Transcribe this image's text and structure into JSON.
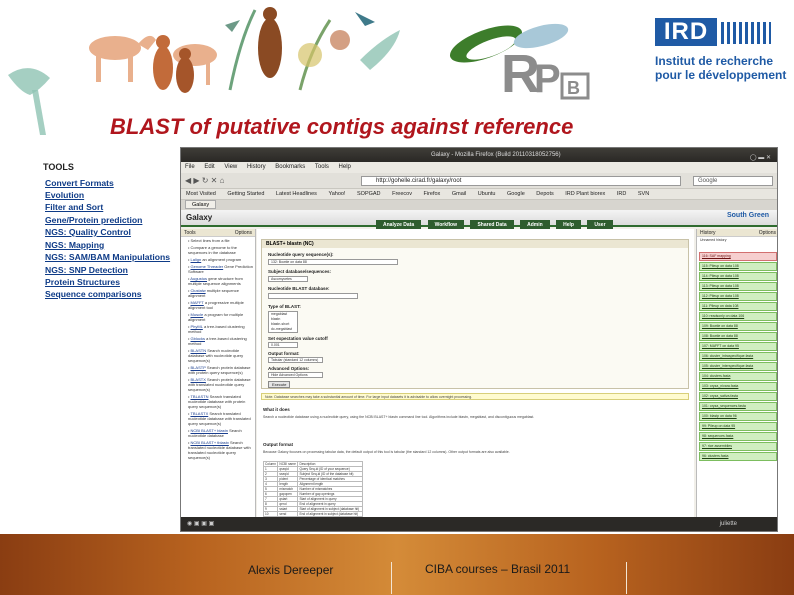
{
  "slide": {
    "title": "BLAST of putative contigs against reference",
    "footer": {
      "author": "Alexis Dereeper",
      "course": "CIBA courses – Brasil 2011"
    }
  },
  "logos": {
    "rpb": "RPB",
    "ird": {
      "wordmark": "IRD",
      "line1": "Institut de recherche",
      "line2": "pour le développement"
    }
  },
  "tools_panel": {
    "title": "TOOLS",
    "items": [
      "Convert Formats",
      "Evolution",
      "Filter and Sort",
      "Gene/Protein prediction",
      "NGS: Quality Control",
      "NGS: Mapping",
      "NGS: SAM/BAM Manipulations",
      "NGS: SNP Detection",
      "Protein Structures",
      "Sequence comparisons"
    ]
  },
  "browser": {
    "window_title": "Galaxy - Mozilla Firefox (Build 20110318052756)",
    "menu": [
      "File",
      "Edit",
      "View",
      "History",
      "Bookmarks",
      "Tools",
      "Help"
    ],
    "url": "http://gohelle.cirad.fr/galaxy/root",
    "search_placeholder": "Google",
    "bookmarks": [
      "Most Visited",
      "Getting Started",
      "Latest Headlines",
      "Yahoo!",
      "SOPGAD",
      "Freecov",
      "Firefox",
      "Gmail",
      "Ubuntu",
      "Google",
      "Depots",
      "IRD Plant biorex",
      "IRD",
      "SVN"
    ],
    "tab": "Galaxy",
    "status_left": "",
    "status_right": "juliette"
  },
  "galaxy": {
    "logo": "Galaxy",
    "tabs": [
      "Analyze Data",
      "Workflow",
      "Shared Data",
      "Admin",
      "Help",
      "User"
    ],
    "brand": "South Green",
    "left_panel": {
      "header": "Tools",
      "options": "Options",
      "items": [
        {
          "link": "",
          "text": "Select lines from a file"
        },
        {
          "link": "",
          "text": "Compare a genome to the sequences in the database"
        },
        {
          "link": "Lalign",
          "text": "an alignment program"
        },
        {
          "link": "Genome Threader",
          "text": "Gene Prediction Software"
        },
        {
          "link": "Augustus",
          "text": "gene structure from multiple sequence alignments"
        },
        {
          "link": "Clustalw",
          "text": "multiple sequence alignment"
        },
        {
          "link": "MAFFT",
          "text": "a progressive multiple alignment tool"
        },
        {
          "link": "Muscle",
          "text": "a program for multiple alignment"
        },
        {
          "link": "PhyML",
          "text": "a tree-based clustering method"
        },
        {
          "link": "Gblocks",
          "text": "a tree-based clustering method"
        },
        {
          "link": "BLASTN",
          "text": "Search nucleotide database with nucleotide query sequence(s)"
        },
        {
          "link": "BLASTP",
          "text": "Search protein database with protein query sequence(s)"
        },
        {
          "link": "BLASTX",
          "text": "Search protein database with translated nucleotide query sequence(s)"
        },
        {
          "link": "TBLASTN",
          "text": "Search translated nucleotide database with protein query sequence(s)"
        },
        {
          "link": "TBLASTX",
          "text": "Search translated nucleotide database with translated query sequence(s)"
        },
        {
          "link": "NCBI BLAST+ blastn",
          "text": "Search nucleotide database"
        },
        {
          "link": "NCBI BLAST+ tblastx",
          "text": "Search translated nucleotide database with translated nucleotide query sequence(s)"
        }
      ]
    },
    "form": {
      "header": "BLAST+ blastn (NC)",
      "query_label": "Nucleotide query sequence(s):",
      "query_value": "132: Bowtie on data 88",
      "subject_label": "Subject database/sequences:",
      "subject_value": "Ascomycetes",
      "db_label": "Nucleotide BLAST database:",
      "db_value": "",
      "type_label": "Type of BLAST:",
      "type_options": [
        "megablast",
        "blastn",
        "blastn-short",
        "dc-megablast"
      ],
      "evalue_label": "Set expectation value cutoff",
      "evalue_value": "0.001",
      "output_label": "Output format:",
      "output_value": "Tabular (standard 12 columns)",
      "advanced_label": "Advanced Options:",
      "advanced_value": "Hide Advanced Options",
      "execute": "Execute"
    },
    "note": "Note. Database searches may take a substantial amount of time. For large input datasets it is advisable to allow overnight processing.",
    "help": {
      "what_title": "What it does",
      "what_text": "Search a nucleotide database using a nucleotide query, using the NCBI BLAST+ blastn command line tool. Algorithms include blastn, megablast, and discontiguous megablast.",
      "output_title": "Output format",
      "output_text": "Because Galaxy focuses on processing tabular data, the default output of this tool is tabular (the standard 12 columns). Other output formats are also available.",
      "table_header": [
        "Column",
        "NCBI name",
        "Description"
      ],
      "table_rows": [
        [
          "1",
          "qseqid",
          "Query Seq-id (ID of your sequence)"
        ],
        [
          "2",
          "sseqid",
          "Subject Seq-id (ID of the database hit)"
        ],
        [
          "3",
          "pident",
          "Percentage of identical matches"
        ],
        [
          "4",
          "length",
          "Alignment length"
        ],
        [
          "5",
          "mismatch",
          "Number of mismatches"
        ],
        [
          "6",
          "gapopen",
          "Number of gap openings"
        ],
        [
          "7",
          "qstart",
          "Start of alignment in query"
        ],
        [
          "8",
          "qend",
          "End of alignment in query"
        ],
        [
          "9",
          "sstart",
          "Start of alignment in subject (database hit)"
        ],
        [
          "10",
          "send",
          "End of alignment in subject (database hit)"
        ]
      ]
    },
    "history": {
      "header": "History",
      "options": "Options",
      "top_text": "Unnamed history",
      "items": [
        {
          "label": "116: SAF mapping",
          "state": "error"
        },
        {
          "label": "115: Pileup on data 108",
          "state": "ok"
        },
        {
          "label": "114: Pileup on data 108",
          "state": "ok"
        },
        {
          "label": "113: Pileup on data 108",
          "state": "ok"
        },
        {
          "label": "112: Pileup on data 108",
          "state": "ok"
        },
        {
          "label": "111: Pileup on data 108",
          "state": "ok"
        },
        {
          "label": "110: readsonly on data 106",
          "state": "ok"
        },
        {
          "label": "109: Bowtie on data 88",
          "state": "ok"
        },
        {
          "label": "108: Bowtie on data 88",
          "state": "ok"
        },
        {
          "label": "107: MAFFT on data 95",
          "state": "ok"
        },
        {
          "label": "106: cluster_intraspecifique.fasta",
          "state": "ok"
        },
        {
          "label": "105: cluster_interspecifique.fasta",
          "state": "ok"
        },
        {
          "label": "104: clusters.fasta",
          "state": "ok"
        },
        {
          "label": "103: oryza_nivara.fasta",
          "state": "ok"
        },
        {
          "label": "102: oryza_sativa.fasta",
          "state": "ok"
        },
        {
          "label": "101: oryza_sequences.fasta",
          "state": "ok"
        },
        {
          "label": "100: blastp on data 96",
          "state": "ok"
        },
        {
          "label": "99: Pileup on data 95",
          "state": "ok"
        },
        {
          "label": "98: sequences.fasta",
          "state": "ok"
        },
        {
          "label": "97: rice assemblies",
          "state": "ok"
        },
        {
          "label": "96: clusters.fasta",
          "state": "ok"
        }
      ]
    }
  },
  "colors": {
    "title": "#b0161d",
    "tool_link": "#0e3b87",
    "footer": "#b8631f",
    "galaxy_tab": "#2f5d2f",
    "history_ok": "#cfeec0",
    "history_error": "#f6cfcf"
  }
}
